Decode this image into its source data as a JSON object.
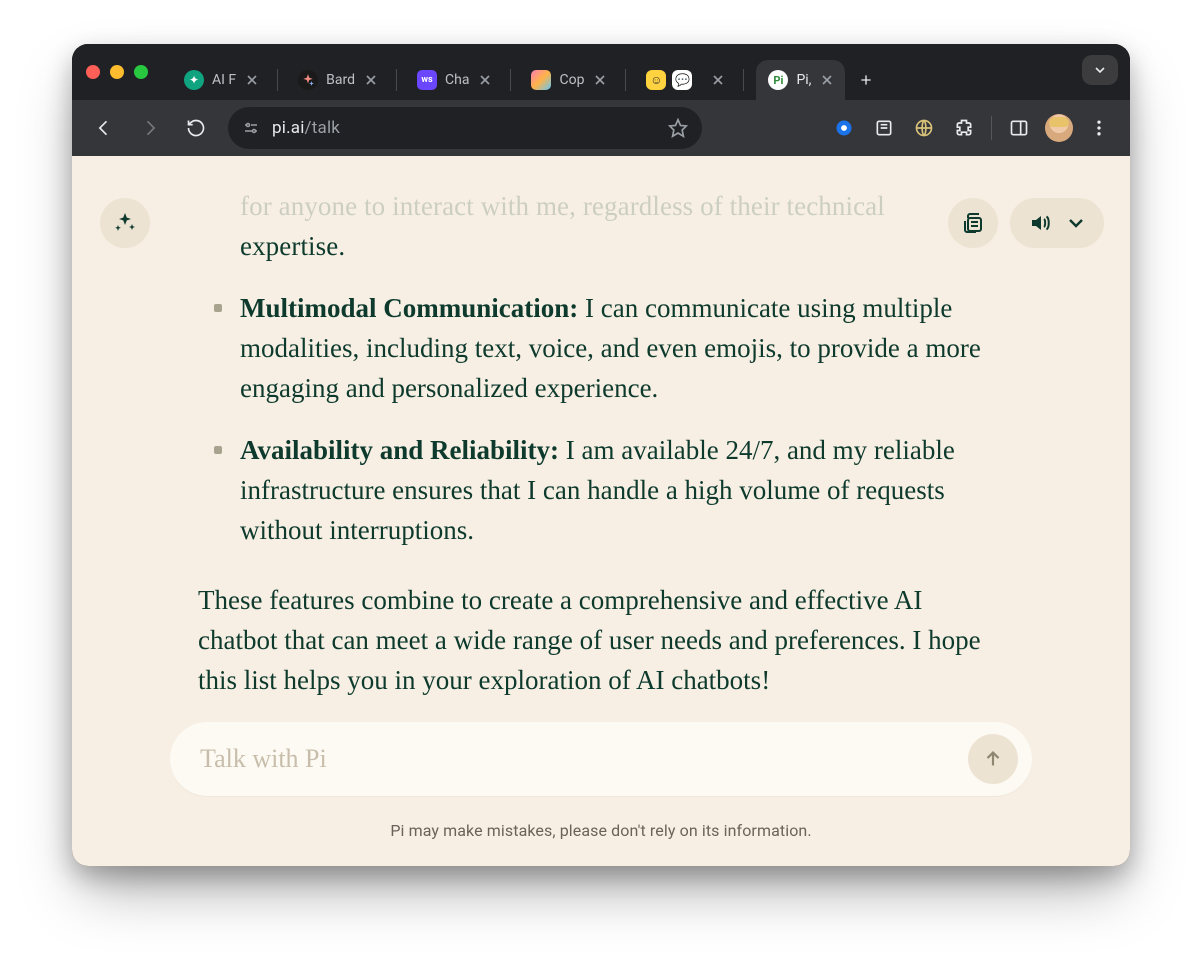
{
  "browser": {
    "tabs": [
      {
        "label": "AI F",
        "favicon_color": "#10a37f",
        "favicon_text": "✦"
      },
      {
        "label": "Bard",
        "favicon_color": "#1a1a1a",
        "favicon_text": "✦"
      },
      {
        "label": "Cha",
        "favicon_color": "#6b46ff",
        "favicon_text": "ws"
      },
      {
        "label": "Cop",
        "favicon_color": "linear",
        "favicon_text": ""
      },
      {
        "label": "",
        "favicon_color": "#ffd23f",
        "favicon_text": "☺"
      }
    ],
    "active_tab": {
      "label": "Pi,",
      "favicon_bg": "#ffffff",
      "favicon_fg": "#2c8a3a",
      "favicon_text": "Pi"
    },
    "url_host": "pi.ai",
    "url_path": "/talk",
    "nav_icons": {
      "back": "back-icon",
      "forward": "forward-icon",
      "reload": "reload-icon",
      "site_settings": "site-settings-icon",
      "bookmark": "star-icon"
    },
    "extension_icons": [
      "record-icon",
      "read-icon",
      "globe-icon",
      "extensions-icon"
    ],
    "right_icons": [
      "sidepanel-icon",
      "avatar",
      "menu-icon"
    ]
  },
  "content": {
    "partial_faded": "for anyone to interact with me, regardless of their technical",
    "partial_clear": "expertise.",
    "bullets": [
      {
        "title": "Multimodal Communication:",
        "body": " I can communicate using multiple modalities, including text, voice, and even emojis, to provide a more engaging and personalized experience."
      },
      {
        "title": "Availability and Reliability:",
        "body": " I am available 24/7, and my reliable infrastructure ensures that I can handle a high volume of requests without interruptions."
      }
    ],
    "closing": "These features combine to create a comprehensive and effective AI chatbot that can meet a wide range of user needs and preferences. I hope this list helps you in your exploration of AI chatbots!",
    "input_placeholder": "Talk with Pi",
    "disclaimer": "Pi may make mistakes, please don't rely on its information."
  }
}
